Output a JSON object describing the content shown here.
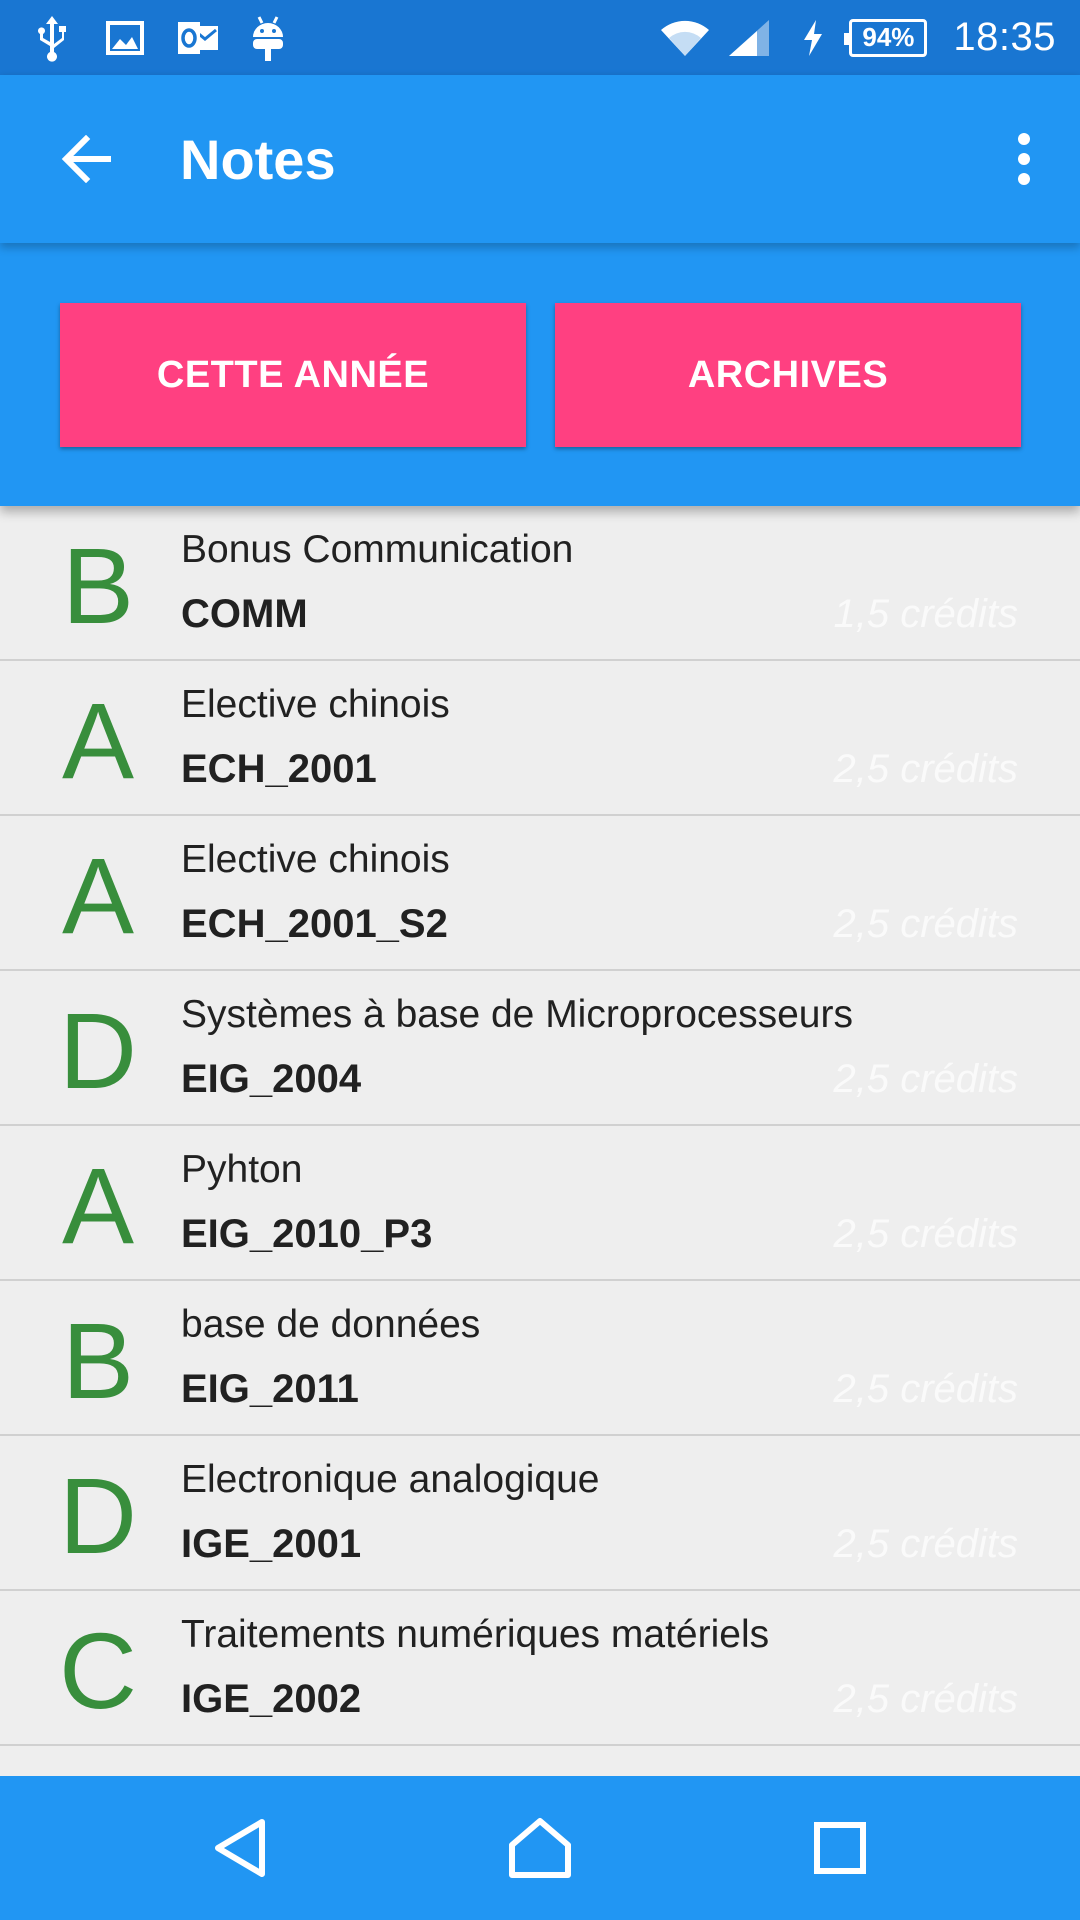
{
  "status_bar": {
    "icons_left": [
      "usb-icon",
      "image-icon",
      "outlook-icon",
      "android-icon"
    ],
    "icons_right": [
      "wifi-icon",
      "signal-icon",
      "charging-icon"
    ],
    "battery": "94%",
    "time": "18:35",
    "color": "#1976d2"
  },
  "toolbar": {
    "title": "Notes",
    "back_icon": "arrow-back-icon",
    "menu_icon": "more-vert-icon",
    "color": "#2196f3"
  },
  "tabs": {
    "this_year": "CETTE ANNÉE",
    "archives": "ARCHIVES",
    "color": "#ff4081"
  },
  "courses": [
    {
      "grade": "B",
      "name": "Bonus Communication",
      "code": "COMM",
      "credits": "1,5 crédits"
    },
    {
      "grade": "A",
      "name": "Elective chinois",
      "code": "ECH_2001",
      "credits": "2,5 crédits"
    },
    {
      "grade": "A",
      "name": "Elective chinois",
      "code": "ECH_2001_S2",
      "credits": "2,5 crédits"
    },
    {
      "grade": "D",
      "name": "Systèmes à base de Microprocesseurs",
      "code": "EIG_2004",
      "credits": "2,5 crédits"
    },
    {
      "grade": "A",
      "name": "Pyhton",
      "code": "EIG_2010_P3",
      "credits": "2,5 crédits"
    },
    {
      "grade": "B",
      "name": "base de données",
      "code": "EIG_2011",
      "credits": "2,5 crédits"
    },
    {
      "grade": "D",
      "name": "Electronique analogique",
      "code": "IGE_2001",
      "credits": "2,5 crédits"
    },
    {
      "grade": "C",
      "name": "Traitements numériques matériels",
      "code": "IGE_2002",
      "credits": "2,5 crédits"
    }
  ],
  "grade_color": "#388e3c",
  "nav_bar": {
    "icons": [
      "nav-back-icon",
      "nav-home-icon",
      "nav-recents-icon"
    ]
  }
}
